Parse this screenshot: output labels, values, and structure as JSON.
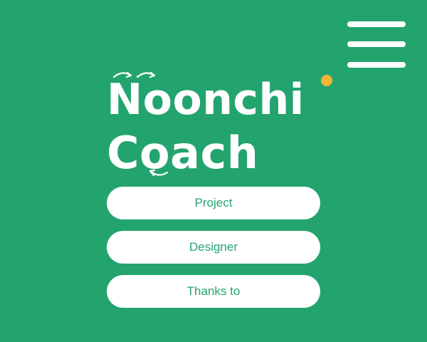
{
  "header": {
    "menu_icon": "hamburger-menu-icon"
  },
  "logo": {
    "line1_a": "N",
    "line1_b": "o",
    "line1_c": "o",
    "line1_d": "nchi",
    "line2_a": "C",
    "line2_b": "o",
    "line2_c": "ach",
    "dot_color": "#f4b532",
    "arc_icon": "refresh-arrows-icon"
  },
  "nav": {
    "items": [
      {
        "label": "Project"
      },
      {
        "label": "Designer"
      },
      {
        "label": "Thanks to"
      }
    ]
  },
  "colors": {
    "background": "#23a46f",
    "pill_background": "#ffffff",
    "pill_text": "#23a46f",
    "accent_dot": "#f4b532"
  }
}
